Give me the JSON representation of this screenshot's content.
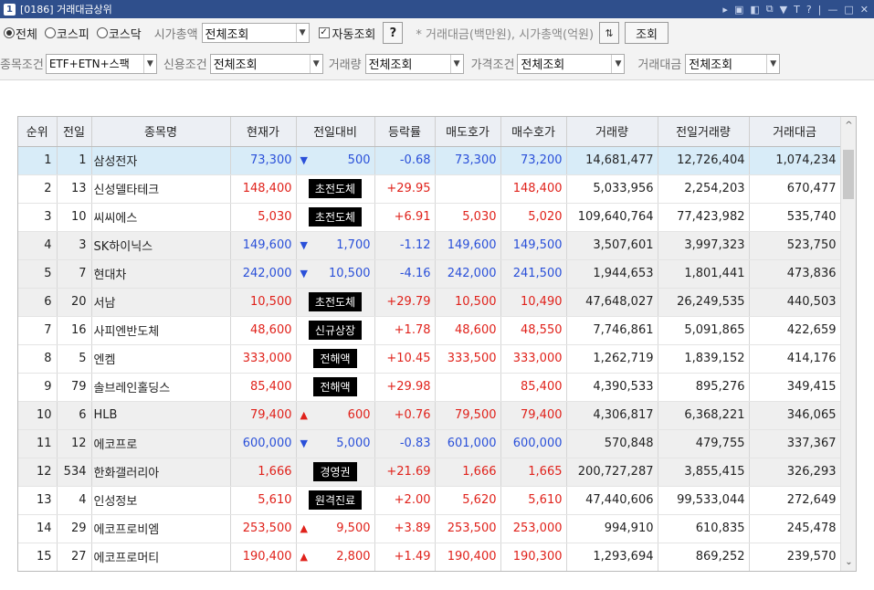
{
  "window": {
    "badge": "1",
    "title": "[0186] 거래대금상위",
    "controls": [
      "▸",
      "▣",
      "◧",
      "⧉",
      "▼",
      "T",
      "?",
      "|",
      "—",
      "□",
      "✕"
    ]
  },
  "filters": {
    "market_options": [
      {
        "label": "전체",
        "checked": true
      },
      {
        "label": "코스피",
        "checked": false
      },
      {
        "label": "코스닥",
        "checked": false
      }
    ],
    "market_cap_label": "시가총액",
    "market_cap_value": "전체조회",
    "auto_query_label": "자동조회",
    "help_label": "?",
    "note": "* 거래대금(백만원), 시가총액(억원)",
    "query_button": "조회",
    "item_condition_label": "종목조건",
    "item_condition_value": "ETF+ETN+스팩",
    "credit_condition_label": "신용조건",
    "credit_condition_value": "전체조회",
    "volume_label": "거래량",
    "volume_value": "전체조회",
    "price_condition_label": "가격조건",
    "price_condition_value": "전체조회",
    "amount_label": "거래대금",
    "amount_value": "전체조회"
  },
  "table": {
    "headers": [
      "순위",
      "전일",
      "종목명",
      "현재가",
      "전일대비",
      "등락률",
      "매도호가",
      "매수호가",
      "거래량",
      "전일거래량",
      "거래대금"
    ],
    "rows": [
      {
        "rank": "1",
        "prev": "1",
        "name": "삼성전자",
        "price": "73,300",
        "price_color": "blue",
        "diff_type": "down",
        "diff": "500",
        "diff_tag": "",
        "rate": "-0.68",
        "rate_color": "blue",
        "ask": "73,300",
        "ask_color": "blue",
        "bid": "73,200",
        "bid_color": "blue",
        "volume": "14,681,477",
        "prev_volume": "12,726,404",
        "amount": "1,074,234",
        "style": "sel-row"
      },
      {
        "rank": "2",
        "prev": "13",
        "name": "신성델타테크",
        "price": "148,400",
        "price_color": "red",
        "diff_type": "tag",
        "diff": "",
        "diff_tag": "초전도체",
        "rate": "+29.95",
        "rate_color": "red",
        "ask": "",
        "ask_color": "red",
        "bid": "148,400",
        "bid_color": "red",
        "volume": "5,033,956",
        "prev_volume": "2,254,203",
        "amount": "670,477",
        "style": ""
      },
      {
        "rank": "3",
        "prev": "10",
        "name": "씨씨에스",
        "price": "5,030",
        "price_color": "red",
        "diff_type": "tag",
        "diff": "",
        "diff_tag": "초전도체",
        "rate": "+6.91",
        "rate_color": "red",
        "ask": "5,030",
        "ask_color": "red",
        "bid": "5,020",
        "bid_color": "red",
        "volume": "109,640,764",
        "prev_volume": "77,423,982",
        "amount": "535,740",
        "style": ""
      },
      {
        "rank": "4",
        "prev": "3",
        "name": "SK하이닉스",
        "price": "149,600",
        "price_color": "blue",
        "diff_type": "down",
        "diff": "1,700",
        "diff_tag": "",
        "rate": "-1.12",
        "rate_color": "blue",
        "ask": "149,600",
        "ask_color": "blue",
        "bid": "149,500",
        "bid_color": "blue",
        "volume": "3,507,601",
        "prev_volume": "3,997,323",
        "amount": "523,750",
        "style": "grey"
      },
      {
        "rank": "5",
        "prev": "7",
        "name": "현대차",
        "price": "242,000",
        "price_color": "blue",
        "diff_type": "down",
        "diff": "10,500",
        "diff_tag": "",
        "rate": "-4.16",
        "rate_color": "blue",
        "ask": "242,000",
        "ask_color": "blue",
        "bid": "241,500",
        "bid_color": "blue",
        "volume": "1,944,653",
        "prev_volume": "1,801,441",
        "amount": "473,836",
        "style": "grey"
      },
      {
        "rank": "6",
        "prev": "20",
        "name": "서남",
        "price": "10,500",
        "price_color": "red",
        "diff_type": "tag",
        "diff": "",
        "diff_tag": "초전도체",
        "rate": "+29.79",
        "rate_color": "red",
        "ask": "10,500",
        "ask_color": "red",
        "bid": "10,490",
        "bid_color": "red",
        "volume": "47,648,027",
        "prev_volume": "26,249,535",
        "amount": "440,503",
        "style": "grey"
      },
      {
        "rank": "7",
        "prev": "16",
        "name": "사피엔반도체",
        "price": "48,600",
        "price_color": "red",
        "diff_type": "tag",
        "diff": "",
        "diff_tag": "신규상장",
        "rate": "+1.78",
        "rate_color": "red",
        "ask": "48,600",
        "ask_color": "red",
        "bid": "48,550",
        "bid_color": "red",
        "volume": "7,746,861",
        "prev_volume": "5,091,865",
        "amount": "422,659",
        "style": ""
      },
      {
        "rank": "8",
        "prev": "5",
        "name": "엔켐",
        "price": "333,000",
        "price_color": "red",
        "diff_type": "tag",
        "diff": "",
        "diff_tag": "전해액",
        "rate": "+10.45",
        "rate_color": "red",
        "ask": "333,500",
        "ask_color": "red",
        "bid": "333,000",
        "bid_color": "red",
        "volume": "1,262,719",
        "prev_volume": "1,839,152",
        "amount": "414,176",
        "style": ""
      },
      {
        "rank": "9",
        "prev": "79",
        "name": "솔브레인홀딩스",
        "price": "85,400",
        "price_color": "red",
        "diff_type": "tag",
        "diff": "",
        "diff_tag": "전해액",
        "rate": "+29.98",
        "rate_color": "red",
        "ask": "",
        "ask_color": "red",
        "bid": "85,400",
        "bid_color": "red",
        "volume": "4,390,533",
        "prev_volume": "895,276",
        "amount": "349,415",
        "style": ""
      },
      {
        "rank": "10",
        "prev": "6",
        "name": "HLB",
        "price": "79,400",
        "price_color": "red",
        "diff_type": "up",
        "diff": "600",
        "diff_tag": "",
        "rate": "+0.76",
        "rate_color": "red",
        "ask": "79,500",
        "ask_color": "red",
        "bid": "79,400",
        "bid_color": "red",
        "volume": "4,306,817",
        "prev_volume": "6,368,221",
        "amount": "346,065",
        "style": "grey"
      },
      {
        "rank": "11",
        "prev": "12",
        "name": "에코프로",
        "price": "600,000",
        "price_color": "blue",
        "diff_type": "down",
        "diff": "5,000",
        "diff_tag": "",
        "rate": "-0.83",
        "rate_color": "blue",
        "ask": "601,000",
        "ask_color": "blue",
        "bid": "600,000",
        "bid_color": "blue",
        "volume": "570,848",
        "prev_volume": "479,755",
        "amount": "337,367",
        "style": "grey"
      },
      {
        "rank": "12",
        "prev": "534",
        "name": "한화갤러리아",
        "price": "1,666",
        "price_color": "red",
        "diff_type": "tag",
        "diff": "",
        "diff_tag": "경영권",
        "rate": "+21.69",
        "rate_color": "red",
        "ask": "1,666",
        "ask_color": "red",
        "bid": "1,665",
        "bid_color": "red",
        "volume": "200,727,287",
        "prev_volume": "3,855,415",
        "amount": "326,293",
        "style": "grey"
      },
      {
        "rank": "13",
        "prev": "4",
        "name": "인성정보",
        "price": "5,610",
        "price_color": "red",
        "diff_type": "tag",
        "diff": "",
        "diff_tag": "원격진료",
        "rate": "+2.00",
        "rate_color": "red",
        "ask": "5,620",
        "ask_color": "red",
        "bid": "5,610",
        "bid_color": "red",
        "volume": "47,440,606",
        "prev_volume": "99,533,044",
        "amount": "272,649",
        "style": ""
      },
      {
        "rank": "14",
        "prev": "29",
        "name": "에코프로비엠",
        "price": "253,500",
        "price_color": "red",
        "diff_type": "up",
        "diff": "9,500",
        "diff_tag": "",
        "rate": "+3.89",
        "rate_color": "red",
        "ask": "253,500",
        "ask_color": "red",
        "bid": "253,000",
        "bid_color": "red",
        "volume": "994,910",
        "prev_volume": "610,835",
        "amount": "245,478",
        "style": ""
      },
      {
        "rank": "15",
        "prev": "27",
        "name": "에코프로머티",
        "price": "190,400",
        "price_color": "red",
        "diff_type": "up",
        "diff": "2,800",
        "diff_tag": "",
        "rate": "+1.49",
        "rate_color": "red",
        "ask": "190,400",
        "ask_color": "red",
        "bid": "190,300",
        "bid_color": "red",
        "volume": "1,293,694",
        "prev_volume": "869,252",
        "amount": "239,570",
        "style": ""
      }
    ]
  },
  "colors": {
    "red": "#e0221b",
    "blue": "#2a50d9",
    "title_bar": "#2f4f8c",
    "selected_row": "#d8ecf8"
  },
  "icons": {
    "sort_button": "sort-arrows-icon",
    "scroll_up": "chevron-up-icon",
    "scroll_down": "chevron-down-icon"
  }
}
